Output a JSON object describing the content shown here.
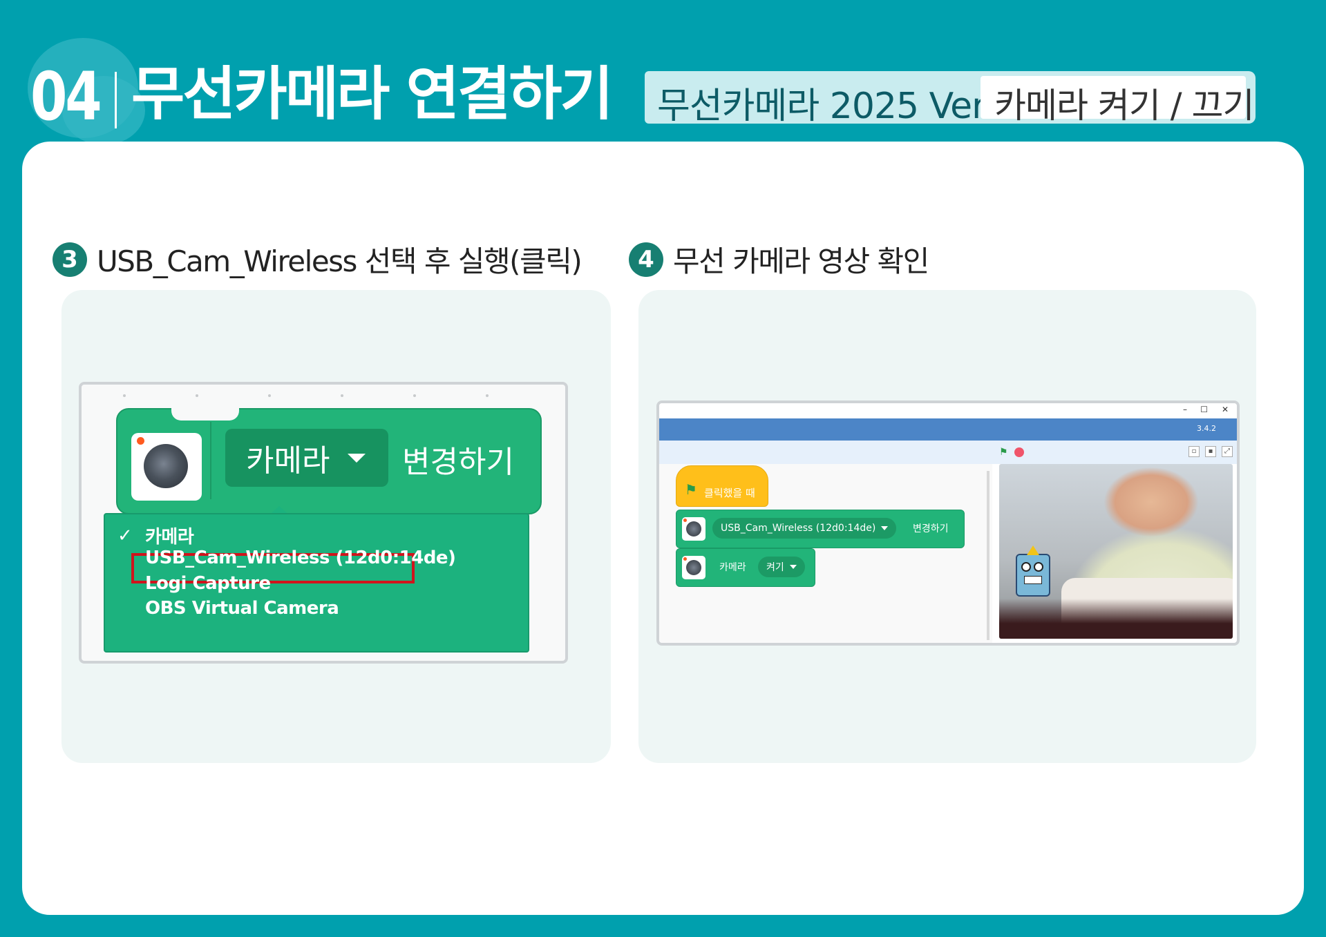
{
  "header": {
    "number": "04",
    "title": "무선카메라 연결하기",
    "product": "무선카메라 2025 Ver",
    "topic": "카메라 켜기 / 끄기"
  },
  "steps": [
    {
      "num": "3",
      "text": "USB_Cam_Wireless 선택 후 실행(클릭)"
    },
    {
      "num": "4",
      "text": "무선 카메라 영상 확인"
    }
  ],
  "zoom_block": {
    "dropdown_value": "카메라",
    "action_label": "변경하기",
    "menu_checkmark": "✓",
    "menu_items": [
      "카메라",
      "USB_Cam_Wireless (12d0:14de)",
      "Logi Capture",
      "OBS Virtual Camera"
    ],
    "checked_index": 0,
    "highlighted_index": 1
  },
  "app_window": {
    "controls": [
      "–",
      "☐",
      "✕"
    ],
    "version": "3.4.2",
    "hat_block_label": "클릭했을 때",
    "block1": {
      "dropdown": "USB_Cam_Wireless (12d0:14de)",
      "action": "변경하기"
    },
    "block2": {
      "label": "카메라",
      "dropdown": "켜기"
    }
  },
  "colors": {
    "background": "#00a0ae",
    "step_badge": "#177f72",
    "block_green": "#22b479",
    "highlight_red": "#d0141c",
    "hat_yellow": "#ffbf1a",
    "menubar_blue": "#4c85c7"
  }
}
